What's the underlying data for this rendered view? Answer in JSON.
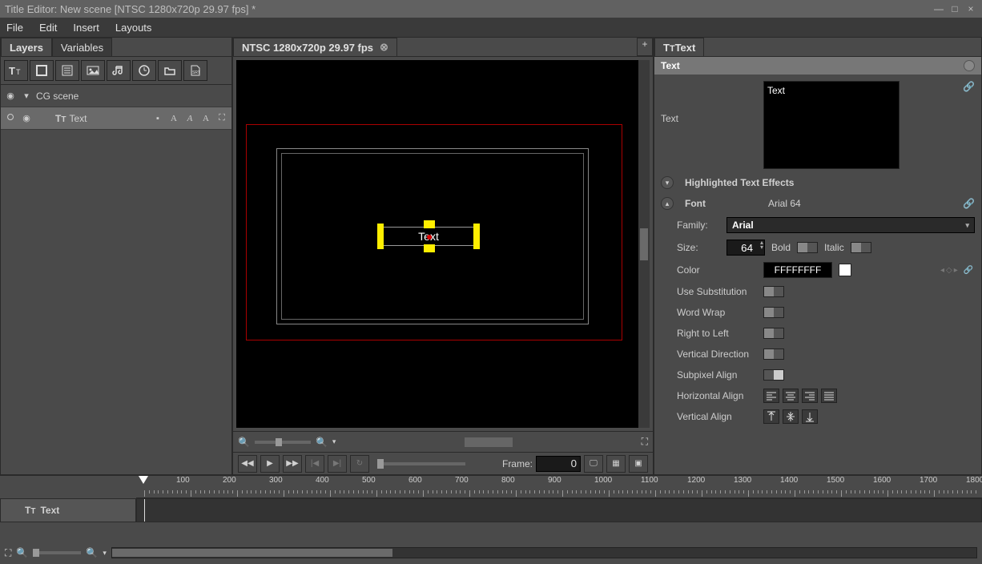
{
  "window": {
    "title": "Title Editor: New scene [NTSC 1280x720p 29.97 fps] *"
  },
  "menu": {
    "file": "File",
    "edit": "Edit",
    "insert": "Insert",
    "layouts": "Layouts"
  },
  "left": {
    "tabs": {
      "layers": "Layers",
      "variables": "Variables"
    },
    "scene_row": "CG scene",
    "text_row": "Text"
  },
  "center": {
    "tab": "NTSC 1280x720p 29.97 fps",
    "text_sample": "Text",
    "frame_label": "Frame:",
    "frame_value": "0"
  },
  "right": {
    "tab_label": "Text",
    "section_text": "Text",
    "text_label": "Text",
    "text_value": "Text",
    "hte": "Highlighted Text Effects",
    "font_label": "Font",
    "font_summary": "Arial 64",
    "family_label": "Family:",
    "family_value": "Arial",
    "size_label": "Size:",
    "size_value": "64",
    "bold_label": "Bold",
    "italic_label": "Italic",
    "color_label": "Color",
    "color_value": "FFFFFFFF",
    "use_sub": "Use Substitution",
    "word_wrap": "Word Wrap",
    "rtl": "Right to Left",
    "vdir": "Vertical Direction",
    "subpixel": "Subpixel Align",
    "halign": "Horizontal Align",
    "valign": "Vertical Align"
  },
  "timeline": {
    "track_label": "Text",
    "ticks": [
      100,
      200,
      300,
      400,
      500,
      600,
      700,
      800,
      900,
      1000,
      1100,
      1200,
      1300,
      1400,
      1500,
      1600,
      1700,
      1800
    ]
  }
}
